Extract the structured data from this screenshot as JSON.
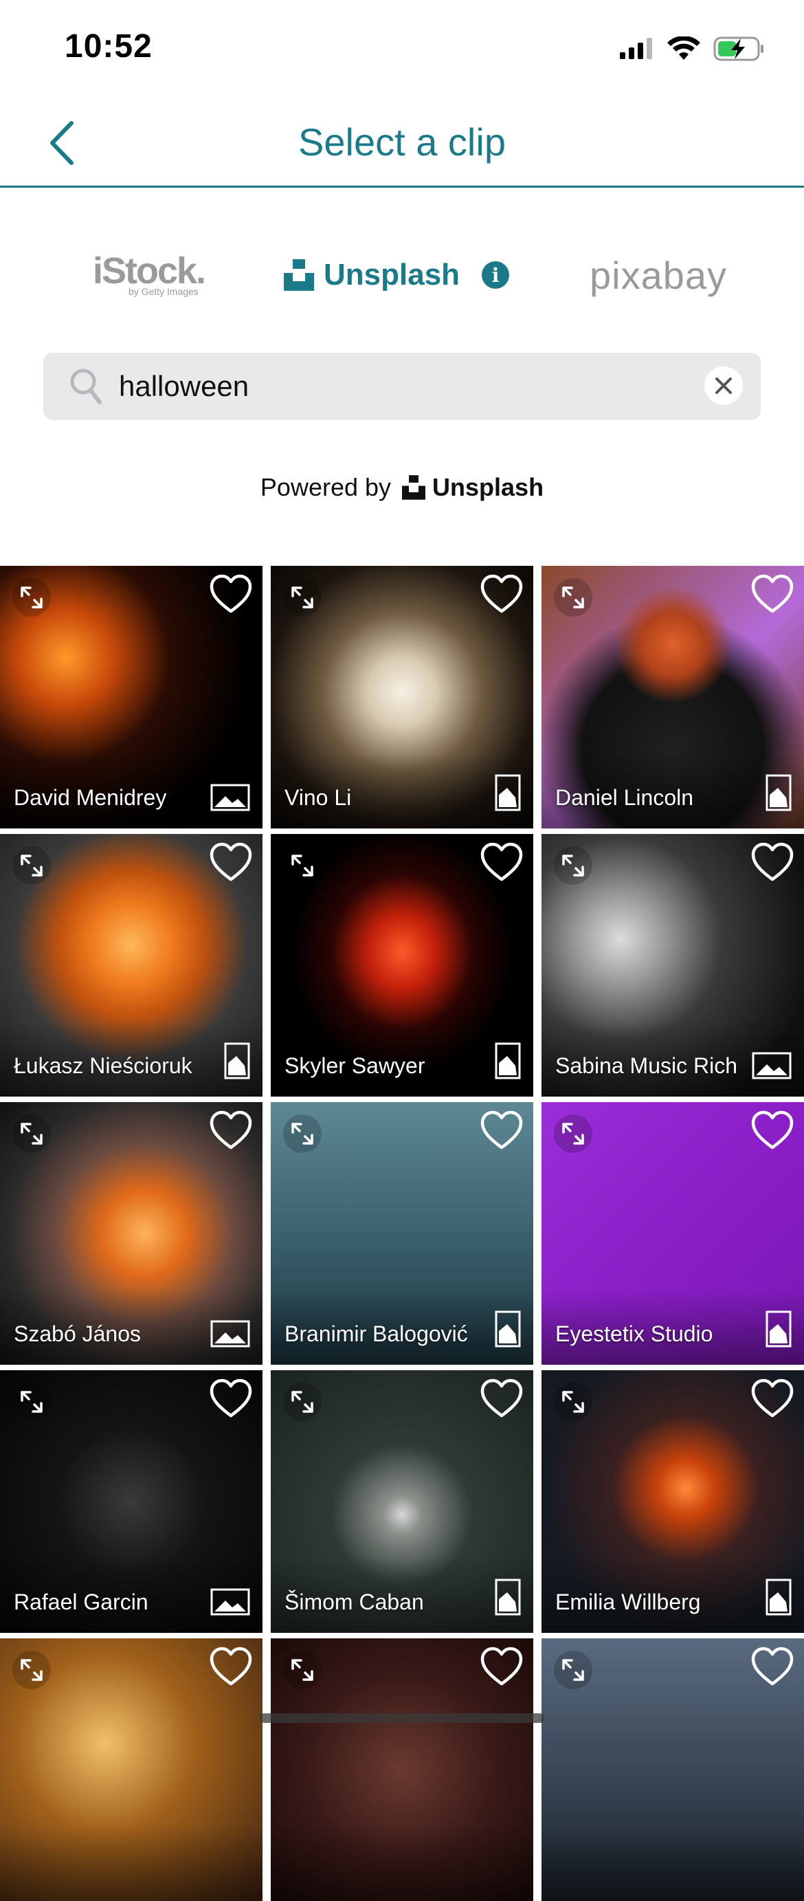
{
  "status": {
    "time": "10:52"
  },
  "nav": {
    "title": "Select a clip"
  },
  "providers": {
    "istock": {
      "name": "iStock.",
      "sub": "by Getty Images"
    },
    "unsplash": {
      "name": "Unsplash"
    },
    "pixabay": {
      "name": "pixabay"
    }
  },
  "search": {
    "value": "halloween"
  },
  "powered": {
    "label": "Powered by",
    "brand": "Unsplash"
  },
  "colors": {
    "accent": "#1b7a8a",
    "search_bg": "#e9e9eb"
  },
  "grid": {
    "tiles": [
      {
        "author": "David Menidrey",
        "orientation": "landscape"
      },
      {
        "author": "Vino Li",
        "orientation": "portrait"
      },
      {
        "author": "Daniel Lincoln",
        "orientation": "portrait"
      },
      {
        "author": "Łukasz Nieścioruk",
        "orientation": "portrait"
      },
      {
        "author": "Skyler Sawyer",
        "orientation": "portrait"
      },
      {
        "author": "Sabina Music Rich",
        "orientation": "landscape"
      },
      {
        "author": "Szabó János",
        "orientation": "landscape"
      },
      {
        "author": "Branimir Balogović",
        "orientation": "portrait"
      },
      {
        "author": "Eyestetix Studio",
        "orientation": "portrait"
      },
      {
        "author": "Rafael Garcin",
        "orientation": "landscape"
      },
      {
        "author": "Šimom Caban",
        "orientation": "portrait"
      },
      {
        "author": "Emilia Willberg",
        "orientation": "portrait"
      },
      {
        "author": "",
        "orientation": ""
      },
      {
        "author": "",
        "orientation": ""
      },
      {
        "author": "",
        "orientation": ""
      }
    ]
  }
}
